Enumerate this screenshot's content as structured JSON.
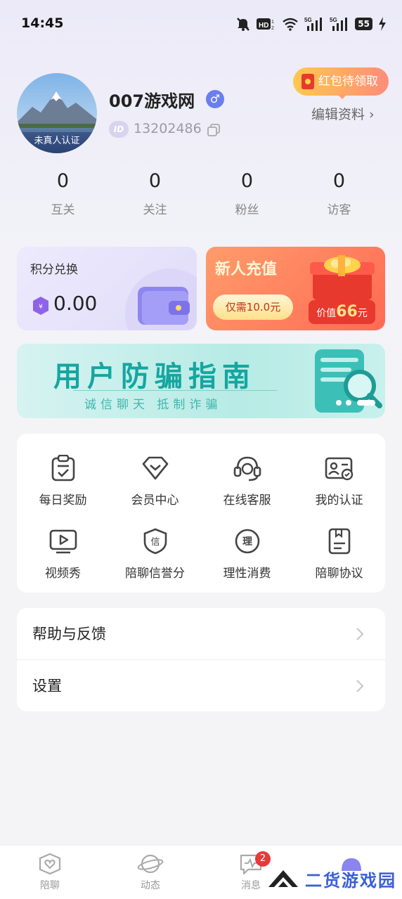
{
  "status_bar": {
    "time": "14:45",
    "battery": "55"
  },
  "profile": {
    "avatar_badge": "未真人认证",
    "nickname": "007游戏网",
    "gender_symbol": "♂",
    "id_label": "ID",
    "id_number": "13202486",
    "red_packet": "红包待领取",
    "edit": "编辑资料 ›"
  },
  "stats": [
    {
      "value": "0",
      "label": "互关"
    },
    {
      "value": "0",
      "label": "关注"
    },
    {
      "value": "0",
      "label": "粉丝"
    },
    {
      "value": "0",
      "label": "访客"
    }
  ],
  "points_card": {
    "title": "积分兑换",
    "value": "0.00",
    "gem_symbol": "¥"
  },
  "recharge_card": {
    "title": "新人充值",
    "button": "仅需10.0元",
    "worth_prefix": "价值",
    "worth_value": "66",
    "worth_suffix": "元"
  },
  "banner": {
    "title": "用户防骗指南",
    "subtitle": "诚信聊天 抵制诈骗"
  },
  "grid": [
    {
      "label": "每日奖励",
      "icon": "clipboard-check-icon"
    },
    {
      "label": "会员中心",
      "icon": "diamond-icon"
    },
    {
      "label": "在线客服",
      "icon": "headset-icon"
    },
    {
      "label": "我的认证",
      "icon": "id-card-icon"
    },
    {
      "label": "视频秀",
      "icon": "video-play-icon"
    },
    {
      "label": "陪聊信誉分",
      "icon": "credit-shield-icon",
      "glyph": "信"
    },
    {
      "label": "理性消费",
      "icon": "rational-circle-icon",
      "glyph": "理"
    },
    {
      "label": "陪聊协议",
      "icon": "document-icon"
    }
  ],
  "menu": [
    {
      "label": "帮助与反馈"
    },
    {
      "label": "设置"
    }
  ],
  "tabbar": [
    {
      "label": "陪聊",
      "icon": "heart-chat-icon"
    },
    {
      "label": "动态",
      "icon": "planet-icon"
    },
    {
      "label": "消息",
      "icon": "message-icon",
      "badge": "2"
    },
    {
      "label": "",
      "icon": "profile-icon"
    }
  ],
  "watermark": {
    "text": "二货游戏园"
  },
  "colors": {
    "accent": "#6a7ef0",
    "teal": "#16a6a0",
    "orange": "#ff7a5c",
    "badge_red": "#e53a3a"
  }
}
